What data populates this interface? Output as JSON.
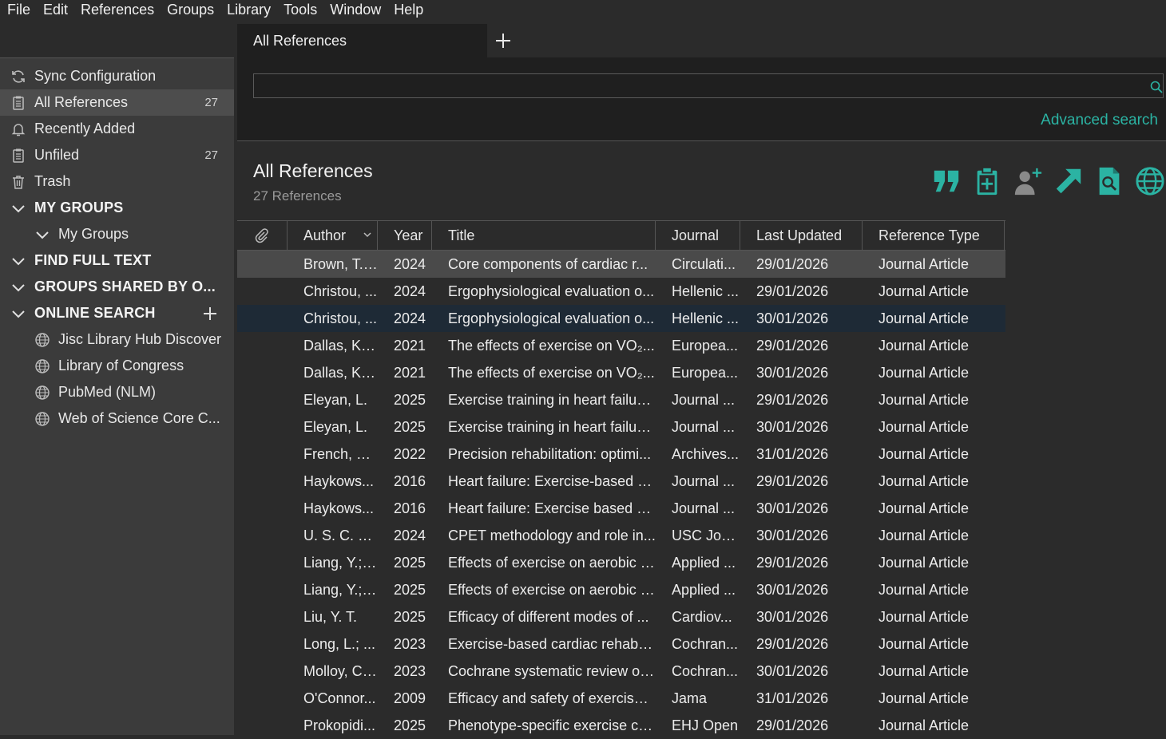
{
  "menu": [
    "File",
    "Edit",
    "References",
    "Groups",
    "Library",
    "Tools",
    "Window",
    "Help"
  ],
  "sidebar": {
    "sync": "Sync Configuration",
    "all_references": {
      "label": "All References",
      "count": "27"
    },
    "recently_added": "Recently Added",
    "unfiled": {
      "label": "Unfiled",
      "count": "27"
    },
    "trash": "Trash",
    "my_groups_section": "MY GROUPS",
    "my_groups": "My Groups",
    "find_full_text": "FIND FULL TEXT",
    "groups_shared": "GROUPS SHARED BY O...",
    "online_search": "ONLINE SEARCH",
    "online_items": [
      "Jisc Library Hub Discover",
      "Library of Congress",
      "PubMed (NLM)",
      "Web of Science Core C..."
    ]
  },
  "tab": {
    "label": "All References"
  },
  "search": {
    "value": "",
    "advanced_label": "Advanced search"
  },
  "library": {
    "title": "All References",
    "count_text": "27 References"
  },
  "toolbar_icons": [
    "quote-icon",
    "clipboard-add-icon",
    "add-user-icon",
    "export-arrow-icon",
    "find-pdf-icon",
    "globe-icon"
  ],
  "colors": {
    "accent": "#2bb3a3",
    "icon": "#2bb3a3"
  },
  "table": {
    "columns": [
      "Author",
      "Year",
      "Title",
      "Journal",
      "Last Updated",
      "Reference Type"
    ],
    "rows": [
      [
        "Brown, T. ...",
        "2024",
        "Core components of cardiac r...",
        "Circulati...",
        "29/01/2026",
        "Journal Article"
      ],
      [
        "Christou, ...",
        "2024",
        "Ergophysiological evaluation o...",
        "Hellenic ...",
        "29/01/2026",
        "Journal Article"
      ],
      [
        "Christou, ...",
        "2024",
        "Ergophysiological evaluation o...",
        "Hellenic ...",
        "30/01/2026",
        "Journal Article"
      ],
      [
        "Dallas, K.;...",
        "2021",
        "The effects of exercise on VO₂...",
        "Europea...",
        "29/01/2026",
        "Journal Article"
      ],
      [
        "Dallas, K.;...",
        "2021",
        "The effects of exercise on VO₂...",
        "Europea...",
        "30/01/2026",
        "Journal Article"
      ],
      [
        "Eleyan, L.",
        "2025",
        "Exercise training in heart failure...",
        "Journal ...",
        "29/01/2026",
        "Journal Article"
      ],
      [
        "Eleyan, L.",
        "2025",
        "Exercise training in heart failure...",
        "Journal ...",
        "30/01/2026",
        "Journal Article"
      ],
      [
        "French, M...",
        "2022",
        "Precision rehabilitation: optimi...",
        "Archives...",
        "31/01/2026",
        "Journal Article"
      ],
      [
        "Haykows...",
        "2016",
        "Heart failure: Exercise-based ca...",
        "Journal ...",
        "29/01/2026",
        "Journal Article"
      ],
      [
        "Haykows...",
        "2016",
        "Heart failure: Exercise based ca...",
        "Journal ...",
        "30/01/2026",
        "Journal Article"
      ],
      [
        "U. S. C. Jo...",
        "2024",
        "CPET methodology and role in...",
        "USC Jou...",
        "30/01/2026",
        "Journal Article"
      ],
      [
        "Liang, Y.; ...",
        "2025",
        "Effects of exercise on aerobic c...",
        "Applied ...",
        "29/01/2026",
        "Journal Article"
      ],
      [
        "Liang, Y.; ...",
        "2025",
        "Effects of exercise on aerobic c...",
        "Applied ...",
        "30/01/2026",
        "Journal Article"
      ],
      [
        "Liu, Y. T.",
        "2025",
        "Efficacy of different modes of ...",
        "Cardiov...",
        "30/01/2026",
        "Journal Article"
      ],
      [
        "Long, L.; ...",
        "2023",
        "Exercise-based cardiac rehabili...",
        "Cochran...",
        "29/01/2026",
        "Journal Article"
      ],
      [
        "Molloy, C....",
        "2023",
        "Cochrane systematic review of...",
        "Cochran...",
        "30/01/2026",
        "Journal Article"
      ],
      [
        "O'Connor...",
        "2009",
        "Efficacy and safety of exercise ...",
        "Jama",
        "31/01/2026",
        "Journal Article"
      ],
      [
        "Prokopidi...",
        "2025",
        "Phenotype-specific exercise ca...",
        "EHJ Open",
        "29/01/2026",
        "Journal Article"
      ]
    ]
  }
}
